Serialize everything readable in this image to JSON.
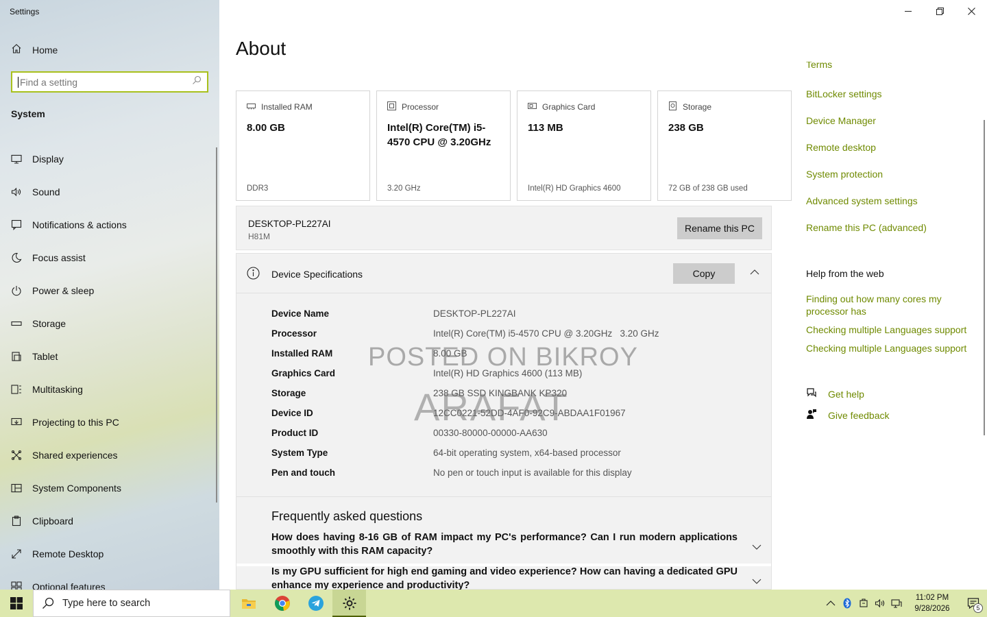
{
  "window": {
    "app_title": "Settings"
  },
  "sidebar": {
    "home_label": "Home",
    "search_placeholder": "Find a setting",
    "section": "System",
    "items": [
      {
        "label": "Display",
        "icon": "display-icon"
      },
      {
        "label": "Sound",
        "icon": "sound-icon"
      },
      {
        "label": "Notifications & actions",
        "icon": "notifications-icon"
      },
      {
        "label": "Focus assist",
        "icon": "focus-assist-icon"
      },
      {
        "label": "Power & sleep",
        "icon": "power-icon"
      },
      {
        "label": "Storage",
        "icon": "storage-icon"
      },
      {
        "label": "Tablet",
        "icon": "tablet-icon"
      },
      {
        "label": "Multitasking",
        "icon": "multitasking-icon"
      },
      {
        "label": "Projecting to this PC",
        "icon": "projecting-icon"
      },
      {
        "label": "Shared experiences",
        "icon": "shared-experiences-icon"
      },
      {
        "label": "System Components",
        "icon": "system-components-icon"
      },
      {
        "label": "Clipboard",
        "icon": "clipboard-icon"
      },
      {
        "label": "Remote Desktop",
        "icon": "remote-desktop-icon"
      },
      {
        "label": "Optional features",
        "icon": "optional-features-icon"
      }
    ]
  },
  "main": {
    "title": "About",
    "cards": [
      {
        "head": "Installed RAM",
        "value": "8.00 GB",
        "sub": "DDR3",
        "icon": "ram-icon"
      },
      {
        "head": "Processor",
        "value": "Intel(R) Core(TM) i5-4570 CPU @ 3.20GHz",
        "sub": "3.20 GHz",
        "icon": "processor-icon"
      },
      {
        "head": "Graphics Card",
        "value": "113 MB",
        "sub": "Intel(R) HD Graphics 4600",
        "icon": "graphics-card-icon"
      },
      {
        "head": "Storage",
        "value": "238 GB",
        "sub": "72 GB of 238 GB used",
        "icon": "storage-drive-icon"
      }
    ],
    "storage_used_fraction": 0.3,
    "pc": {
      "name": "DESKTOP-PL227AI",
      "model": "H81M",
      "rename_label": "Rename this PC"
    },
    "specs": {
      "title": "Device Specifications",
      "copy_label": "Copy",
      "rows": [
        {
          "label": "Device Name",
          "value": "DESKTOP-PL227AI"
        },
        {
          "label": "Processor",
          "value": "Intel(R) Core(TM) i5-4570 CPU @ 3.20GHz   3.20 GHz"
        },
        {
          "label": "Installed RAM",
          "value": "8.00 GB"
        },
        {
          "label": "Graphics Card",
          "value": "Intel(R) HD Graphics 4600 (113 MB)"
        },
        {
          "label": "Storage",
          "value": "238 GB SSD KINGBANK KP320"
        },
        {
          "label": "Device ID",
          "value": "12CC0221-52DD-4AF0-92C9-ABDAA1F01967"
        },
        {
          "label": "Product ID",
          "value": "00330-80000-00000-AA630"
        },
        {
          "label": "System Type",
          "value": "64-bit operating system, x64-based processor"
        },
        {
          "label": "Pen and touch",
          "value": "No pen or touch input is available for this display"
        }
      ]
    },
    "faq": {
      "title": "Frequently asked questions",
      "items": [
        "How does having 8-16 GB of RAM impact my PC's performance? Can I run modern applications smoothly with this RAM capacity?",
        "Is my GPU sufficient for high end gaming and video experience? How can having a dedicated GPU enhance my experience and productivity?"
      ]
    },
    "watermark": {
      "line1": "POSTED ON BIKROY",
      "line2": "ARAFAT"
    }
  },
  "related": {
    "links": [
      "Terms",
      "BitLocker settings",
      "Device Manager",
      "Remote desktop",
      "System protection",
      "Advanced system settings",
      "Rename this PC (advanced)"
    ],
    "help_title": "Help from the web",
    "web_links": [
      "Finding out how many cores my processor has",
      "Checking multiple Languages support",
      "Checking multiple Languages support"
    ],
    "get_help": "Get help",
    "give_feedback": "Give feedback"
  },
  "taskbar": {
    "search_placeholder": "Type here to search",
    "apps": [
      "file-explorer-icon",
      "chrome-icon",
      "telegram-icon",
      "settings-icon"
    ],
    "time": "11:02 PM",
    "date": "9/28/2026",
    "notification_count": "5"
  },
  "colors": {
    "accent": "#6f8a00",
    "search_border": "#a8c01c",
    "taskbar": "#dde8ae"
  }
}
